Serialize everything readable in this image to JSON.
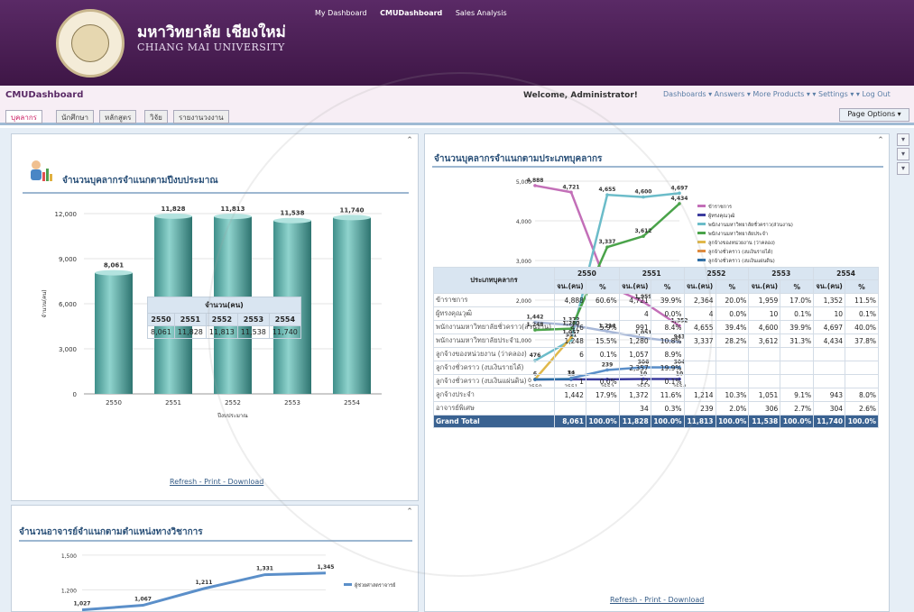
{
  "header": {
    "university_thai": "มหาวิทยาลัย เชียงใหม่",
    "university_en": "CHIANG MAI UNIVERSITY",
    "nav": [
      "My Dashboard",
      "CMUDashboard",
      "Sales Analysis"
    ],
    "active_nav": "CMUDashboard"
  },
  "titlebar": {
    "app_title": "CMUDashboard",
    "welcome": "Welcome, Administrator!",
    "user_nav": "Dashboards ▾ Answers ▾ More Products ▾ ▾ Settings ▾ ▾ Log Out"
  },
  "tabs": [
    "บุคลากร",
    "นักศึกษา",
    "หลักสูตร",
    "วิจัย",
    "รายงานวงงาน"
  ],
  "page_options": "Page Options ▾",
  "panel_budget": {
    "title": "จำนวนบุคลากรจำแนกตามปีงบประมาณ",
    "table_header": "จำนวน(คน)",
    "years": [
      "2550",
      "2551",
      "2552",
      "2553",
      "2554"
    ],
    "values": [
      "8,061",
      "11,828",
      "11,813",
      "11,538",
      "11,740"
    ],
    "links": "Refresh - Print - Download"
  },
  "panel_academic": {
    "title": "จำนวนอาจารย์จำแนกตามตำแหน่งทางวิชาการ",
    "legend": "ผู้ช่วยศาสตราจารย์"
  },
  "panel_type": {
    "title": "จำนวนบุคลากรจำแนกตามประเภทบุคลากร",
    "legend": [
      "ข้าราชการ",
      "ผู้ทรงคุณวุฒิ",
      "พนักงานมหาวิทยาลัยชั่วคราว(ส่วนงาน)",
      "พนักงานมหาวิทยาลัยประจำ",
      "ลูกจ้างของหน่วยงาน (ว่าคลอง)",
      "ลูกจ้างชั่วคราว (งบเงินรายได้)",
      "ลูกจ้างชั่วคราว (งบเงินแผ่นดิน)",
      "ลูกจ้างประจำ",
      "อาจารย์พิเศษ"
    ],
    "table": {
      "row_header": "ประเภทบุคลากร",
      "sub_headers": [
        "จน.(คน)",
        "%"
      ],
      "rows": [
        [
          "ข้าราชการ",
          "4,888",
          "60.6%",
          "4,721",
          "39.9%",
          "2,364",
          "20.0%",
          "1,959",
          "17.0%",
          "1,352",
          "11.5%"
        ],
        [
          "ผู้ทรงคุณวุฒิ",
          "",
          "",
          "4",
          "0.0%",
          "4",
          "0.0%",
          "10",
          "0.1%",
          "10",
          "0.1%"
        ],
        [
          "พนักงานมหาวิทยาลัยชั่วคราว(ส่วนงาน)",
          "476",
          "5.9%",
          "991",
          "8.4%",
          "4,655",
          "39.4%",
          "4,600",
          "39.9%",
          "4,697",
          "40.0%"
        ],
        [
          "พนักงานมหาวิทยาลัยประจำ",
          "1,248",
          "15.5%",
          "1,280",
          "10.8%",
          "3,337",
          "28.2%",
          "3,612",
          "31.3%",
          "4,434",
          "37.8%"
        ],
        [
          "ลูกจ้างของหน่วยงาน (ว่าคลอง)",
          "6",
          "0.1%",
          "1,057",
          "8.9%",
          "",
          "",
          "",
          "",
          "",
          ""
        ],
        [
          "ลูกจ้างชั่วคราว (งบเงินรายได้)",
          "",
          "",
          "2,357",
          "19.9%",
          "",
          "",
          "",
          "",
          "",
          ""
        ],
        [
          "ลูกจ้างชั่วคราว (งบเงินแผ่นดิน)",
          "1",
          "0.0%",
          "12",
          "0.1%",
          "",
          "",
          "",
          "",
          "",
          ""
        ],
        [
          "ลูกจ้างประจำ",
          "1,442",
          "17.9%",
          "1,372",
          "11.6%",
          "1,214",
          "10.3%",
          "1,051",
          "9.1%",
          "943",
          "8.0%"
        ],
        [
          "อาจารย์พิเศษ",
          "",
          "",
          "34",
          "0.3%",
          "239",
          "2.0%",
          "306",
          "2.7%",
          "304",
          "2.6%"
        ]
      ],
      "total": [
        "Grand Total",
        "8,061",
        "100.0%",
        "11,828",
        "100.0%",
        "11,813",
        "100.0%",
        "11,538",
        "100.0%",
        "11,740",
        "100.0%"
      ]
    },
    "links": "Refresh - Print - Download"
  },
  "chart_data": [
    {
      "type": "bar",
      "title": "จำนวนบุคลากรจำแนกตามปีงบประมาณ",
      "categories": [
        "2550",
        "2551",
        "2552",
        "2553",
        "2554"
      ],
      "values": [
        8061,
        11828,
        11813,
        11538,
        11740
      ],
      "data_labels": [
        "8,061",
        "11,828",
        "11,813",
        "11,538",
        "11,740"
      ],
      "ylim": [
        0,
        12000
      ],
      "yticks": [
        "12,000",
        "9,000",
        "6,000",
        "3,000",
        "0"
      ],
      "xlabel": "ปีงบประมาณ",
      "ylabel": "จำนวน(คน)"
    },
    {
      "type": "line",
      "title": "จำนวนบุคลากรจำแนกตามประเภทบุคลากร",
      "categories": [
        "2550",
        "2551",
        "2552",
        "2553",
        "2554"
      ],
      "ylim": [
        0,
        5000
      ],
      "yticks": [
        "5,000",
        "4,000",
        "3,000",
        "2,000",
        "1,000",
        "0"
      ],
      "xlabel": "ปีงบประมาณ",
      "ylabel": "จน.(คน)",
      "series": [
        {
          "name": "ข้าราชการ",
          "color": "#c36fb8",
          "values": [
            4888,
            4721,
            2364,
            1959,
            1352
          ]
        },
        {
          "name": "ผู้ทรงคุณวุฒิ",
          "color": "#3c3c9e",
          "values": [
            0,
            4,
            4,
            10,
            10
          ]
        },
        {
          "name": "พนักงานมหาวิทยาลัยชั่วคราว(ส่วนงาน)",
          "color": "#6bbcc9",
          "values": [
            476,
            991,
            4655,
            4600,
            4697
          ]
        },
        {
          "name": "พนักงานมหาวิทยาลัยประจำ",
          "color": "#4aa34a",
          "values": [
            1248,
            1280,
            3337,
            3612,
            4434
          ]
        },
        {
          "name": "ลูกจ้างของหน่วยงาน (ว่าคลอง)",
          "color": "#e0b84a",
          "values": [
            6,
            1057,
            null,
            null,
            null
          ]
        },
        {
          "name": "ลูกจ้างชั่วคราว (งบเงินรายได้)",
          "color": "#e08a3c",
          "values": [
            null,
            2357,
            null,
            null,
            null
          ]
        },
        {
          "name": "ลูกจ้างชั่วคราว (งบเงินแผ่นดิน)",
          "color": "#2e6ea6",
          "values": [
            1,
            12,
            null,
            null,
            null
          ]
        },
        {
          "name": "ลูกจ้างประจำ",
          "color": "#a8b8d8",
          "values": [
            1442,
            1372,
            1214,
            1051,
            943
          ]
        },
        {
          "name": "อาจารย์พิเศษ",
          "color": "#5b8fc9",
          "values": [
            null,
            34,
            239,
            306,
            304
          ]
        }
      ],
      "data_labels": [
        "4,888",
        "4,721",
        "4,655",
        "4,600",
        "4,697",
        "4,434",
        "3,337",
        "3,612",
        "2,357",
        "2,364",
        "1,959",
        "1,442",
        "1,248",
        "1,380",
        "991",
        "1,314",
        "1,051",
        "1,352",
        "943",
        "476",
        "239",
        "306",
        "304",
        "6",
        "4",
        "10",
        "10",
        "0"
      ]
    },
    {
      "type": "line",
      "title": "จำนวนอาจารย์จำแนกตามตำแหน่งทางวิชาการ",
      "categories": [
        "2550",
        "2551",
        "2552",
        "2553",
        "2554"
      ],
      "yticks": [
        "1,500",
        "1,200"
      ],
      "series": [
        {
          "name": "ผู้ช่วยศาสตราจารย์",
          "color": "#5b8fc9",
          "values": [
            1027,
            1067,
            1211,
            1331,
            1345
          ]
        }
      ],
      "data_labels": [
        "1,027",
        "1,067",
        "1,211",
        "1,331",
        "1,345"
      ]
    }
  ]
}
